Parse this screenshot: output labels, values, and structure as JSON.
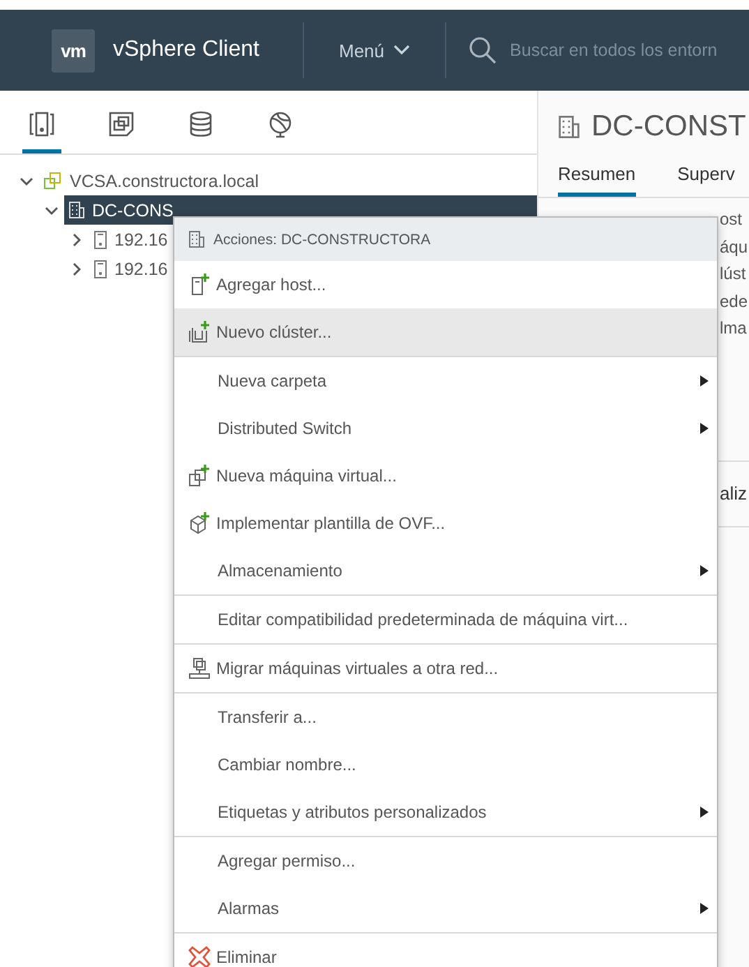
{
  "header": {
    "logo": "vm",
    "title": "vSphere Client",
    "menu": "Menú",
    "search": {
      "placeholder": "Buscar en todos los entorn"
    }
  },
  "navigator": {
    "tabs": [
      {
        "kind": "hosts",
        "selected": true
      },
      {
        "kind": "vms",
        "selected": false
      },
      {
        "kind": "storage",
        "selected": false
      },
      {
        "kind": "network",
        "selected": false
      }
    ],
    "tree": [
      {
        "label": "VCSA.constructora.local",
        "kind": "vcenter",
        "expanded": true,
        "selected": false,
        "children": [
          {
            "label": "DC-CONS",
            "kind": "datacenter",
            "expanded": true,
            "selected": true,
            "children": [
              {
                "label": "192.16",
                "kind": "host",
                "expanded": false,
                "selected": false
              },
              {
                "label": "192.16",
                "kind": "host",
                "expanded": false,
                "selected": false
              }
            ]
          }
        ]
      }
    ]
  },
  "content": {
    "title": "DC-CONST",
    "tabs": [
      {
        "label": "Resumen",
        "selected": true
      },
      {
        "label": "Superv",
        "selected": false
      }
    ],
    "details": [
      "ost",
      "áqu",
      "lúst",
      "ede",
      "lma"
    ],
    "section": "aliz"
  },
  "context_menu": {
    "header": "Acciones: DC-CONSTRUCTORA",
    "groups": [
      [
        {
          "label": "Agregar host...",
          "kind": "add-host",
          "submenu": false,
          "selected": false
        },
        {
          "label": "Nuevo clúster...",
          "kind": "add-cluster",
          "submenu": false,
          "selected": true
        }
      ],
      [
        {
          "label": "Nueva carpeta",
          "submenu": true,
          "selected": false
        },
        {
          "label": "Distributed Switch",
          "submenu": true,
          "selected": false
        },
        {
          "label": "Nueva máquina virtual...",
          "kind": "add-vm",
          "submenu": false,
          "selected": false
        },
        {
          "label": "Implementar plantilla de OVF...",
          "kind": "add-ovf",
          "submenu": false,
          "selected": false
        },
        {
          "label": "Almacenamiento",
          "submenu": true,
          "selected": false
        }
      ],
      [
        {
          "label": "Editar compatibilidad predeterminada de máquina virt...",
          "submenu": false,
          "selected": false
        }
      ],
      [
        {
          "label": "Migrar máquinas virtuales a otra red...",
          "kind": "migrate",
          "submenu": false,
          "selected": false
        }
      ],
      [
        {
          "label": "Transferir a...",
          "submenu": false,
          "selected": false
        },
        {
          "label": "Cambiar nombre...",
          "submenu": false,
          "selected": false
        },
        {
          "label": "Etiquetas y atributos personalizados",
          "submenu": true,
          "selected": false
        }
      ],
      [
        {
          "label": "Agregar permiso...",
          "submenu": false,
          "selected": false
        },
        {
          "label": "Alarmas",
          "submenu": true,
          "selected": false
        }
      ],
      [
        {
          "label": "Eliminar",
          "kind": "delete",
          "submenu": false,
          "selected": false
        }
      ]
    ]
  }
}
